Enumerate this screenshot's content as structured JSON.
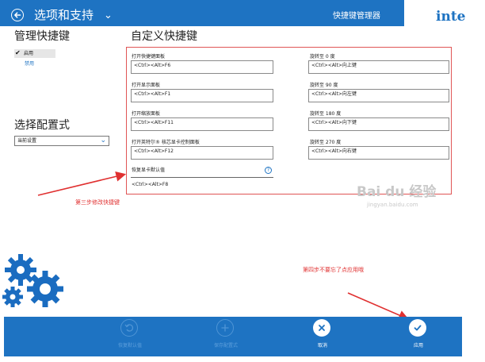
{
  "header": {
    "title": "选项和支持",
    "section_title": "快捷键管理器",
    "logo_text": "inte"
  },
  "sidebar": {
    "manage_heading": "管理快捷键",
    "enable_label": "启用",
    "disable_label": "禁用",
    "config_heading": "选择配置式",
    "config_value": "当前设置"
  },
  "main": {
    "heading": "自定义快捷键",
    "fields_left": [
      {
        "label": "打开快捷键面板",
        "value": "<Ctrl><Alt>F6"
      },
      {
        "label": "打开显示面板",
        "value": "<Ctrl><Alt>F1"
      },
      {
        "label": "打开缩放面板",
        "value": "<Ctrl><Alt>F11"
      },
      {
        "label": "打开英特尔® 核芯显卡控制面板",
        "value": "<Ctrl><Alt>F12"
      }
    ],
    "fields_right": [
      {
        "label": "旋转至 0 度",
        "value": "<Ctrl><Alt>向上键"
      },
      {
        "label": "旋转至 90 度",
        "value": "<Ctrl><Alt>向左键"
      },
      {
        "label": "旋转至 180 度",
        "value": "<Ctrl><Alt>向下键"
      },
      {
        "label": "旋转至 270 度",
        "value": "<Ctrl><Alt>向右键"
      }
    ],
    "restore_label": "恢复显卡默认值",
    "restore_value": "<Ctrl><Alt>F8",
    "help_glyph": "?"
  },
  "annotations": {
    "step3": "第三步修改快捷键",
    "step4": "第四步不要忘了点应用哦",
    "color": "#e03030"
  },
  "watermark": {
    "main": "Bai du 经验",
    "sub": "jingyan.baidu.com"
  },
  "bottombar": {
    "restore_defaults": "恢复默认值",
    "save_profile": "保存配置式",
    "cancel": "取消",
    "apply": "应用"
  },
  "colors": {
    "brand_blue": "#1e73c2",
    "panel_border": "#e05555",
    "gear_blue": "#1a6cc0"
  },
  "icons": [
    "back-arrow-icon",
    "chevron-down-icon",
    "check-icon",
    "undo-icon",
    "plus-icon",
    "close-icon",
    "checkmark-icon",
    "gear-icon"
  ]
}
